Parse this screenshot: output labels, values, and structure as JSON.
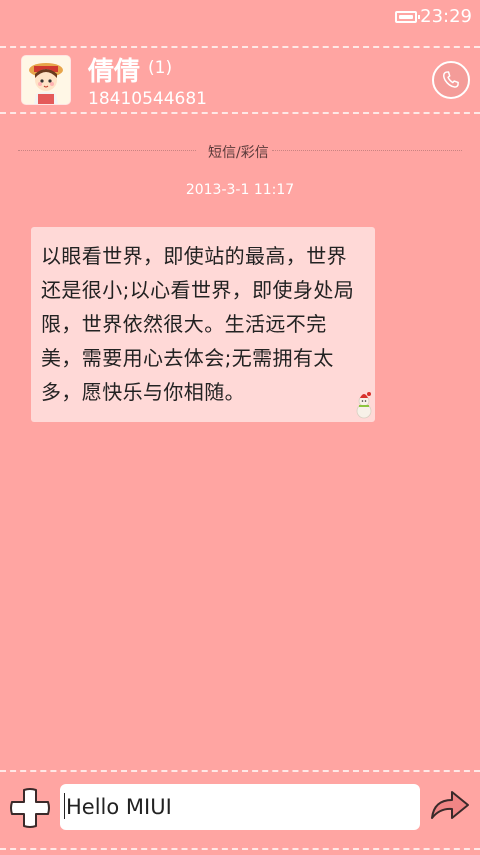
{
  "status_bar": {
    "time": "23:29",
    "icons": [
      "battery-icon"
    ]
  },
  "header": {
    "contact_name": "倩倩",
    "message_count": "(1)",
    "phone_number": "18410544681",
    "call_icon": "phone-icon"
  },
  "thread": {
    "divider_label": "短信/彩信",
    "timestamp": "2013-3-1 11:17",
    "messages": [
      {
        "text": "以眼看世界，即使站的最高，世界还是很小;以心看世界，即使身处局限，世界依然很大。生活远不完美，需要用心去体会;无需拥有太多，愿快乐与你相随。",
        "direction": "incoming"
      }
    ]
  },
  "compose": {
    "input_value": "Hello MIUI",
    "add_icon": "plus-icon",
    "send_icon": "send-arrow-icon"
  },
  "colors": {
    "background": "#ffa5a2",
    "bubble": "#ffd9d7",
    "header_text": "#ffffff"
  }
}
